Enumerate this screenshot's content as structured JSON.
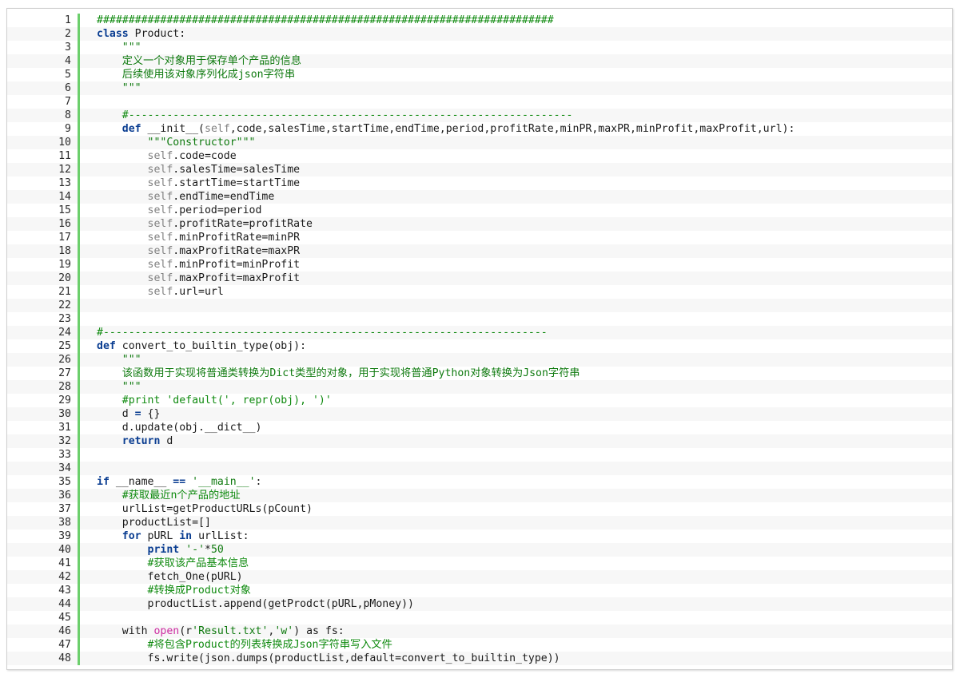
{
  "lines": [
    {
      "n": "1",
      "tokens": [
        {
          "t": "cmt",
          "v": "########################################################################"
        }
      ]
    },
    {
      "n": "2",
      "tokens": [
        {
          "t": "kw",
          "v": "class"
        },
        {
          "t": "",
          "v": " Product:"
        }
      ]
    },
    {
      "n": "3",
      "tokens": [
        {
          "t": "str",
          "v": "    \"\"\""
        }
      ]
    },
    {
      "n": "4",
      "tokens": [
        {
          "t": "str",
          "v": "    定义一个对象用于保存单个产品的信息"
        }
      ]
    },
    {
      "n": "5",
      "tokens": [
        {
          "t": "str",
          "v": "    后续使用该对象序列化成json字符串"
        }
      ]
    },
    {
      "n": "6",
      "tokens": [
        {
          "t": "str",
          "v": "    \"\"\""
        }
      ]
    },
    {
      "n": "7",
      "tokens": [
        {
          "t": "",
          "v": ""
        }
      ]
    },
    {
      "n": "8",
      "tokens": [
        {
          "t": "cmt",
          "v": "    #----------------------------------------------------------------------"
        }
      ]
    },
    {
      "n": "9",
      "tokens": [
        {
          "t": "",
          "v": "    "
        },
        {
          "t": "kw",
          "v": "def"
        },
        {
          "t": "",
          "v": " __init__("
        },
        {
          "t": "self",
          "v": "self"
        },
        {
          "t": "",
          "v": ",code,salesTime,startTime,endTime,period,profitRate,minPR,maxPR,minProfit,maxProfit,url):"
        }
      ]
    },
    {
      "n": "10",
      "tokens": [
        {
          "t": "str",
          "v": "        \"\"\"Constructor\"\"\""
        }
      ]
    },
    {
      "n": "11",
      "tokens": [
        {
          "t": "self",
          "v": "        self"
        },
        {
          "t": "",
          "v": ".code=code"
        }
      ]
    },
    {
      "n": "12",
      "tokens": [
        {
          "t": "self",
          "v": "        self"
        },
        {
          "t": "",
          "v": ".salesTime=salesTime"
        }
      ]
    },
    {
      "n": "13",
      "tokens": [
        {
          "t": "self",
          "v": "        self"
        },
        {
          "t": "",
          "v": ".startTime=startTime"
        }
      ]
    },
    {
      "n": "14",
      "tokens": [
        {
          "t": "self",
          "v": "        self"
        },
        {
          "t": "",
          "v": ".endTime=endTime"
        }
      ]
    },
    {
      "n": "15",
      "tokens": [
        {
          "t": "self",
          "v": "        self"
        },
        {
          "t": "",
          "v": ".period=period"
        }
      ]
    },
    {
      "n": "16",
      "tokens": [
        {
          "t": "self",
          "v": "        self"
        },
        {
          "t": "",
          "v": ".profitRate=profitRate"
        }
      ]
    },
    {
      "n": "17",
      "tokens": [
        {
          "t": "self",
          "v": "        self"
        },
        {
          "t": "",
          "v": ".minProfitRate=minPR"
        }
      ]
    },
    {
      "n": "18",
      "tokens": [
        {
          "t": "self",
          "v": "        self"
        },
        {
          "t": "",
          "v": ".maxProfitRate=maxPR"
        }
      ]
    },
    {
      "n": "19",
      "tokens": [
        {
          "t": "self",
          "v": "        self"
        },
        {
          "t": "",
          "v": ".minProfit=minProfit"
        }
      ]
    },
    {
      "n": "20",
      "tokens": [
        {
          "t": "self",
          "v": "        self"
        },
        {
          "t": "",
          "v": ".maxProfit=maxProfit"
        }
      ]
    },
    {
      "n": "21",
      "tokens": [
        {
          "t": "self",
          "v": "        self"
        },
        {
          "t": "",
          "v": ".url=url"
        }
      ]
    },
    {
      "n": "22",
      "tokens": [
        {
          "t": "",
          "v": ""
        }
      ]
    },
    {
      "n": "23",
      "tokens": [
        {
          "t": "",
          "v": ""
        }
      ]
    },
    {
      "n": "24",
      "tokens": [
        {
          "t": "cmt",
          "v": "#----------------------------------------------------------------------"
        }
      ]
    },
    {
      "n": "25",
      "tokens": [
        {
          "t": "kw",
          "v": "def"
        },
        {
          "t": "",
          "v": " convert_to_builtin_type(obj):"
        }
      ]
    },
    {
      "n": "26",
      "tokens": [
        {
          "t": "str",
          "v": "    \"\"\""
        }
      ]
    },
    {
      "n": "27",
      "tokens": [
        {
          "t": "str",
          "v": "    该函数用于实现将普通类转换为Dict类型的对象，用于实现将普通Python对象转换为Json字符串"
        }
      ]
    },
    {
      "n": "28",
      "tokens": [
        {
          "t": "str",
          "v": "    \"\"\""
        }
      ]
    },
    {
      "n": "29",
      "tokens": [
        {
          "t": "cmt",
          "v": "    #print 'default(', repr(obj), ')'"
        }
      ]
    },
    {
      "n": "30",
      "tokens": [
        {
          "t": "",
          "v": "    d "
        },
        {
          "t": "kw",
          "v": "="
        },
        {
          "t": "",
          "v": " {}"
        }
      ]
    },
    {
      "n": "31",
      "tokens": [
        {
          "t": "",
          "v": "    d.update(obj.__dict__)"
        }
      ]
    },
    {
      "n": "32",
      "tokens": [
        {
          "t": "",
          "v": "    "
        },
        {
          "t": "kw",
          "v": "return"
        },
        {
          "t": "",
          "v": " d"
        }
      ]
    },
    {
      "n": "33",
      "tokens": [
        {
          "t": "",
          "v": ""
        }
      ]
    },
    {
      "n": "34",
      "tokens": [
        {
          "t": "",
          "v": ""
        }
      ]
    },
    {
      "n": "35",
      "tokens": [
        {
          "t": "kw",
          "v": "if"
        },
        {
          "t": "",
          "v": " __name__ "
        },
        {
          "t": "kw",
          "v": "=="
        },
        {
          "t": "",
          "v": " "
        },
        {
          "t": "str",
          "v": "'__main__'"
        },
        {
          "t": "",
          "v": ":"
        }
      ]
    },
    {
      "n": "36",
      "tokens": [
        {
          "t": "cmt",
          "v": "    #获取最近n个产品的地址"
        }
      ]
    },
    {
      "n": "37",
      "tokens": [
        {
          "t": "",
          "v": "    urlList=getProductURLs(pCount)"
        }
      ]
    },
    {
      "n": "38",
      "tokens": [
        {
          "t": "",
          "v": "    productList=[]"
        }
      ]
    },
    {
      "n": "39",
      "tokens": [
        {
          "t": "",
          "v": "    "
        },
        {
          "t": "kw",
          "v": "for"
        },
        {
          "t": "",
          "v": " pURL "
        },
        {
          "t": "kw",
          "v": "in"
        },
        {
          "t": "",
          "v": " urlList:"
        }
      ]
    },
    {
      "n": "40",
      "tokens": [
        {
          "t": "",
          "v": "        "
        },
        {
          "t": "kw",
          "v": "print"
        },
        {
          "t": "",
          "v": " "
        },
        {
          "t": "str",
          "v": "'-'"
        },
        {
          "t": "",
          "v": "*"
        },
        {
          "t": "num",
          "v": "50"
        }
      ]
    },
    {
      "n": "41",
      "tokens": [
        {
          "t": "cmt",
          "v": "        #获取该产品基本信息"
        }
      ]
    },
    {
      "n": "42",
      "tokens": [
        {
          "t": "",
          "v": "        fetch_One(pURL)"
        }
      ]
    },
    {
      "n": "43",
      "tokens": [
        {
          "t": "cmt",
          "v": "        #转换成Product对象"
        }
      ]
    },
    {
      "n": "44",
      "tokens": [
        {
          "t": "",
          "v": "        productList.append(getProdct(pURL,pMoney))"
        }
      ]
    },
    {
      "n": "45",
      "tokens": [
        {
          "t": "",
          "v": ""
        }
      ]
    },
    {
      "n": "46",
      "tokens": [
        {
          "t": "",
          "v": "    with "
        },
        {
          "t": "builtin",
          "v": "open"
        },
        {
          "t": "",
          "v": "(r"
        },
        {
          "t": "str",
          "v": "'Result.txt'"
        },
        {
          "t": "",
          "v": ","
        },
        {
          "t": "str",
          "v": "'w'"
        },
        {
          "t": "",
          "v": ") as fs:"
        }
      ]
    },
    {
      "n": "47",
      "tokens": [
        {
          "t": "cmt",
          "v": "        #将包含Product的列表转换成Json字符串写入文件"
        }
      ]
    },
    {
      "n": "48",
      "tokens": [
        {
          "t": "",
          "v": "        fs.write(json.dumps(productList,default=convert_to_builtin_type))"
        }
      ]
    }
  ],
  "colors": {
    "keyword": "#0a3d91",
    "string": "#0f7a0f",
    "comment": "#0f8a0f",
    "self": "#808080",
    "builtin": "#cc2aa0",
    "gutter": "#6ccf6c"
  }
}
